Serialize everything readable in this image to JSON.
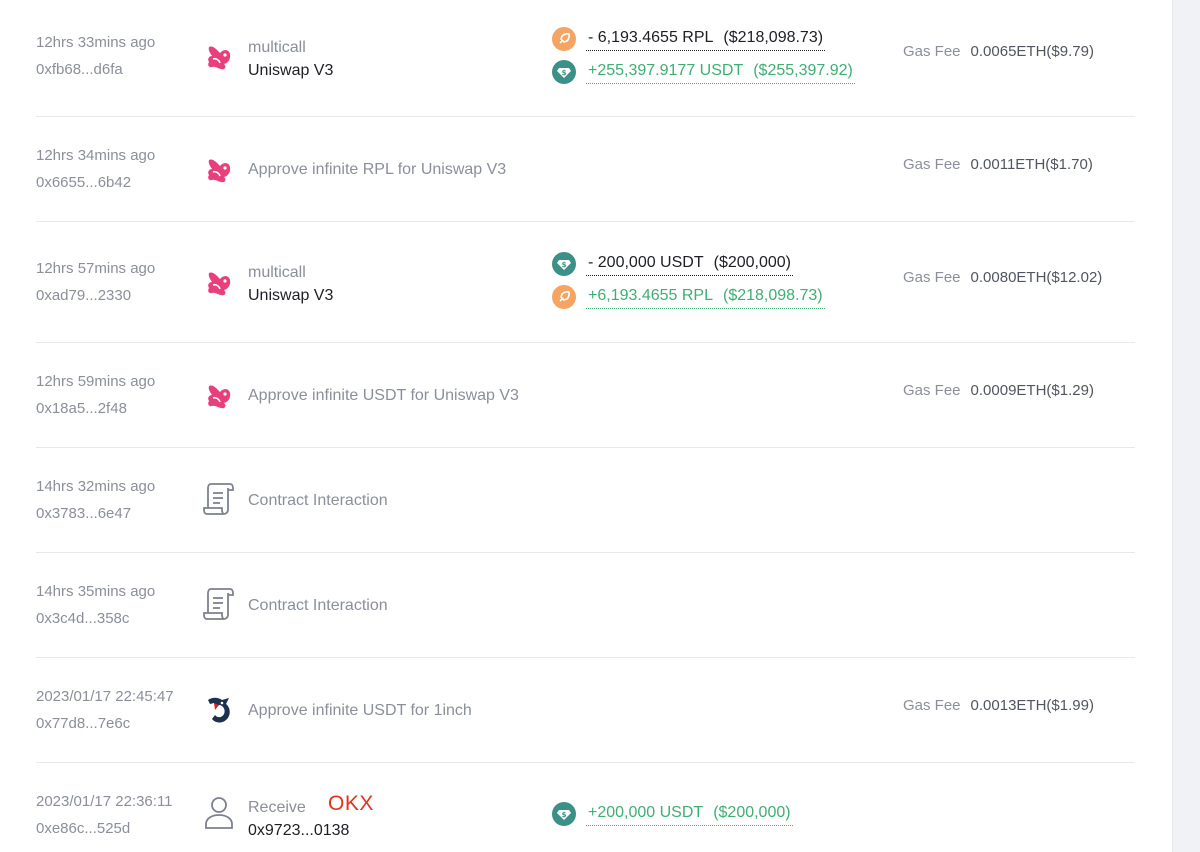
{
  "transactions": [
    {
      "time": "12hrs 33mins ago",
      "hash": "0xfb68...d6fa",
      "icon": "uniswap-icon",
      "method": "multicall",
      "protocol": "Uniswap V3",
      "tokens": [
        {
          "icon": "rpl-token-icon",
          "sign": "neg",
          "amount": "- 6,193.4655 RPL",
          "usd": "($218,098.73)"
        },
        {
          "icon": "usdt-token-icon",
          "sign": "pos",
          "amount": "+255,397.9177 USDT",
          "usd": "($255,397.92)"
        }
      ],
      "gas_label": "Gas Fee",
      "gas_value": "0.0065ETH($9.79)"
    },
    {
      "time": "12hrs 34mins ago",
      "hash": "0x6655...6b42",
      "icon": "uniswap-icon",
      "description": "Approve infinite RPL for Uniswap V3",
      "gas_label": "Gas Fee",
      "gas_value": "0.0011ETH($1.70)"
    },
    {
      "time": "12hrs 57mins ago",
      "hash": "0xad79...2330",
      "icon": "uniswap-icon",
      "method": "multicall",
      "protocol": "Uniswap V3",
      "tokens": [
        {
          "icon": "usdt-token-icon",
          "sign": "neg",
          "amount": "- 200,000 USDT",
          "usd": "($200,000)"
        },
        {
          "icon": "rpl-token-icon",
          "sign": "pos",
          "amount": "+6,193.4655 RPL",
          "usd": "($218,098.73)"
        }
      ],
      "gas_label": "Gas Fee",
      "gas_value": "0.0080ETH($12.02)"
    },
    {
      "time": "12hrs 59mins ago",
      "hash": "0x18a5...2f48",
      "icon": "uniswap-icon",
      "description": "Approve infinite USDT for Uniswap V3",
      "gas_label": "Gas Fee",
      "gas_value": "0.0009ETH($1.29)"
    },
    {
      "time": "14hrs 32mins ago",
      "hash": "0x3783...6e47",
      "icon": "contract-scroll-icon",
      "description": "Contract Interaction"
    },
    {
      "time": "14hrs 35mins ago",
      "hash": "0x3c4d...358c",
      "icon": "contract-scroll-icon",
      "description": "Contract Interaction"
    },
    {
      "time": "2023/01/17 22:45:47",
      "hash": "0x77d8...7e6c",
      "icon": "1inch-icon",
      "description": "Approve infinite USDT for 1inch",
      "gas_label": "Gas Fee",
      "gas_value": "0.0013ETH($1.99)"
    },
    {
      "time": "2023/01/17 22:36:11",
      "hash": "0xe86c...525d",
      "icon": "user-icon",
      "method": "Receive",
      "protocol": "0x9723...0138",
      "annotation": "OKX",
      "tokens": [
        {
          "icon": "usdt-token-icon",
          "sign": "pos",
          "amount": "+200,000 USDT",
          "usd": "($200,000)"
        }
      ]
    }
  ],
  "colors": {
    "positive": "#3fae73",
    "negative": "#1d1f25",
    "muted": "#8b8f9a",
    "rpl": "#f4a463",
    "usdt": "#3b9087",
    "uniswap": "#e8407a",
    "annotation": "#e0351d"
  }
}
